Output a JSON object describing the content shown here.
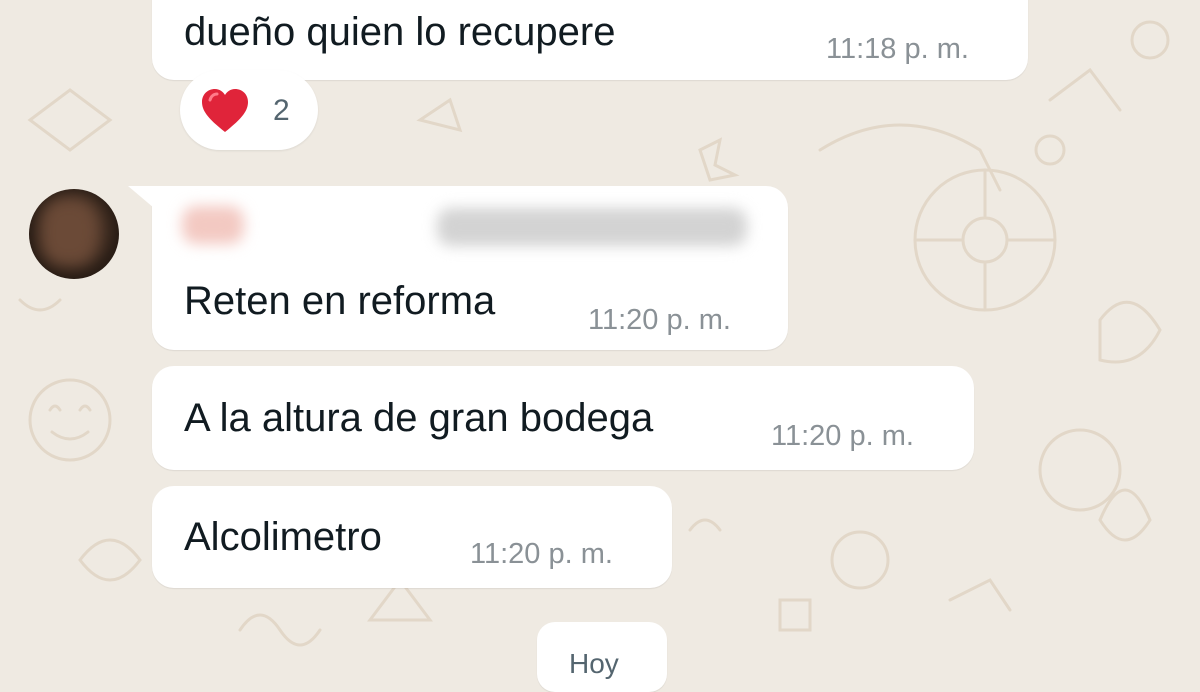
{
  "messages": [
    {
      "text": "dueño quien lo recupere",
      "time": "11:18 p. m.",
      "reaction": {
        "emoji": "heart-icon",
        "count": "2"
      }
    },
    {
      "sender": {
        "name_blurred": true,
        "phone_blurred": true
      },
      "text": "Reten en reforma",
      "time": "11:20 p. m."
    },
    {
      "text": "A la altura de gran bodega",
      "time": "11:20 p. m."
    },
    {
      "text": "Alcolimetro",
      "time": "11:20 p. m."
    }
  ],
  "date_separator": "Hoy",
  "colors": {
    "background": "#efeae2",
    "bubble": "#ffffff",
    "text": "#111b21",
    "timestamp": "#8a9196",
    "heart": "#e0243a"
  }
}
